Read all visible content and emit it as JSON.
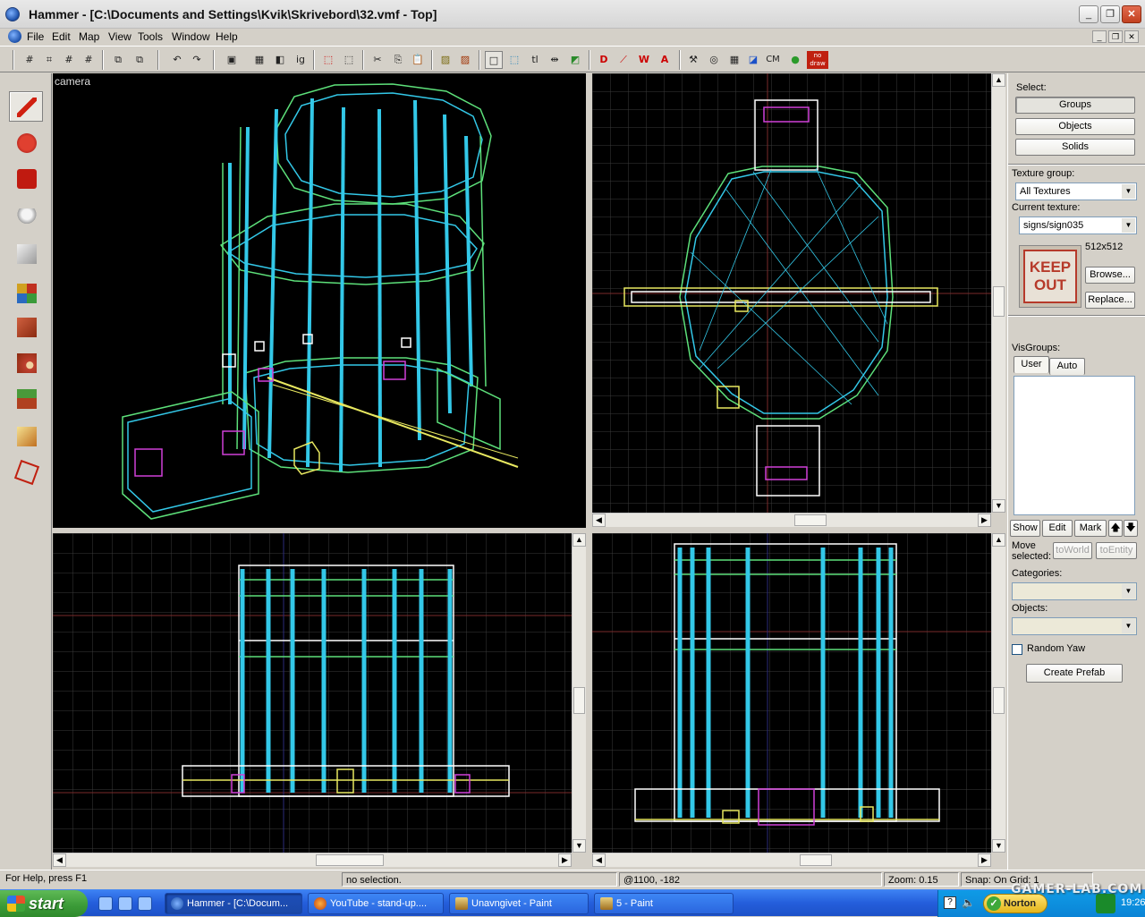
{
  "window": {
    "title": "Hammer - [C:\\Documents and Settings\\Kvik\\Skrivebord\\32.vmf - Top]",
    "buttons": {
      "minimize": "_",
      "maximize": "❐",
      "close": "✕"
    }
  },
  "menu": {
    "items": [
      "File",
      "Edit",
      "Map",
      "View",
      "Tools",
      "Window",
      "Help"
    ],
    "mdi_buttons": {
      "minimize": "_",
      "restore": "❐",
      "close": "✕"
    }
  },
  "toolbar": {
    "tools": [
      "grid-toggle-icon",
      "3d-grid-icon",
      "smaller-grid-icon",
      "larger-grid-icon",
      "group-icon",
      "ungroup-icon",
      "undo-icon",
      "redo-icon",
      "carve-icon",
      "hollow-icon",
      "hide-icon",
      "ignore-groups-icon",
      "cordon-icon",
      "cut-icon",
      "copy-icon",
      "paste-icon",
      "texture-lock-icon",
      "texture-scale-icon",
      "select-box-icon",
      "selection-icon",
      "tl-icon",
      "toggle-helpers-icon",
      "models-icon",
      "toggle-3d-icon",
      "toggle-2d-icon",
      "run-map-icon",
      "display-icon",
      "entity-report-icon",
      "check-problems-icon",
      "map-info-icon",
      "cubemap-icon",
      "sky-icon",
      "nodraw-icon"
    ],
    "labels": {
      "ig": "ig",
      "tl": "tl",
      "cm": "CM",
      "nodraw": "no draw"
    }
  },
  "left_tools": [
    "selection-tool-icon",
    "magnify-tool-icon",
    "camera-tool-icon",
    "entity-tool-icon",
    "block-tool-icon",
    "texture-application-icon",
    "apply-current-texture-icon",
    "decal-tool-icon",
    "overlay-tool-icon",
    "clipping-tool-icon",
    "vertex-tool-icon"
  ],
  "viewports": {
    "camera": {
      "label": "camera"
    },
    "top": {
      "label": ""
    },
    "front": {
      "label": ""
    },
    "side": {
      "label": ""
    }
  },
  "panel": {
    "select_label": "Select:",
    "select_buttons": [
      "Groups",
      "Objects",
      "Solids"
    ],
    "texture_group_label": "Texture group:",
    "texture_group_value": "All Textures",
    "current_texture_label": "Current texture:",
    "current_texture_value": "signs/sign035",
    "texture_size": "512x512",
    "texture_preview_text_1": "KEEP",
    "texture_preview_text_2": "OUT",
    "browse_button": "Browse...",
    "replace_button": "Replace...",
    "visgroups_label": "VisGroups:",
    "vis_tabs": [
      "User",
      "Auto"
    ],
    "vis_buttons": [
      "Show",
      "Edit",
      "Mark"
    ],
    "move_selected_label": "Move selected:",
    "to_world_button": "toWorld",
    "to_entity_button": "toEntity",
    "categories_label": "Categories:",
    "objects_label": "Objects:",
    "random_yaw_label": "Random Yaw",
    "create_prefab_button": "Create Prefab"
  },
  "status": {
    "help": "For Help, press F1",
    "selection": "no selection.",
    "coords": "@1100, -182",
    "zoom": "Zoom: 0.15",
    "snap": "Snap: On Grid: 1"
  },
  "taskbar": {
    "start_label": "start",
    "tasks": [
      "Hammer - [C:\\Docum...",
      "YouTube - stand-up....",
      "Unavngivet - Paint",
      "5 - Paint"
    ],
    "norton_label": "Norton",
    "clock": "19:26"
  },
  "watermark": "GAMER-LAB.COM",
  "colors": {
    "wire_cyan": "#33c8e8",
    "wire_green": "#5de07a",
    "wire_magenta": "#d040d8",
    "wire_yellow": "#e8e860",
    "grid": "#3a3a3a",
    "grid_axis": "#7a2a2a"
  }
}
